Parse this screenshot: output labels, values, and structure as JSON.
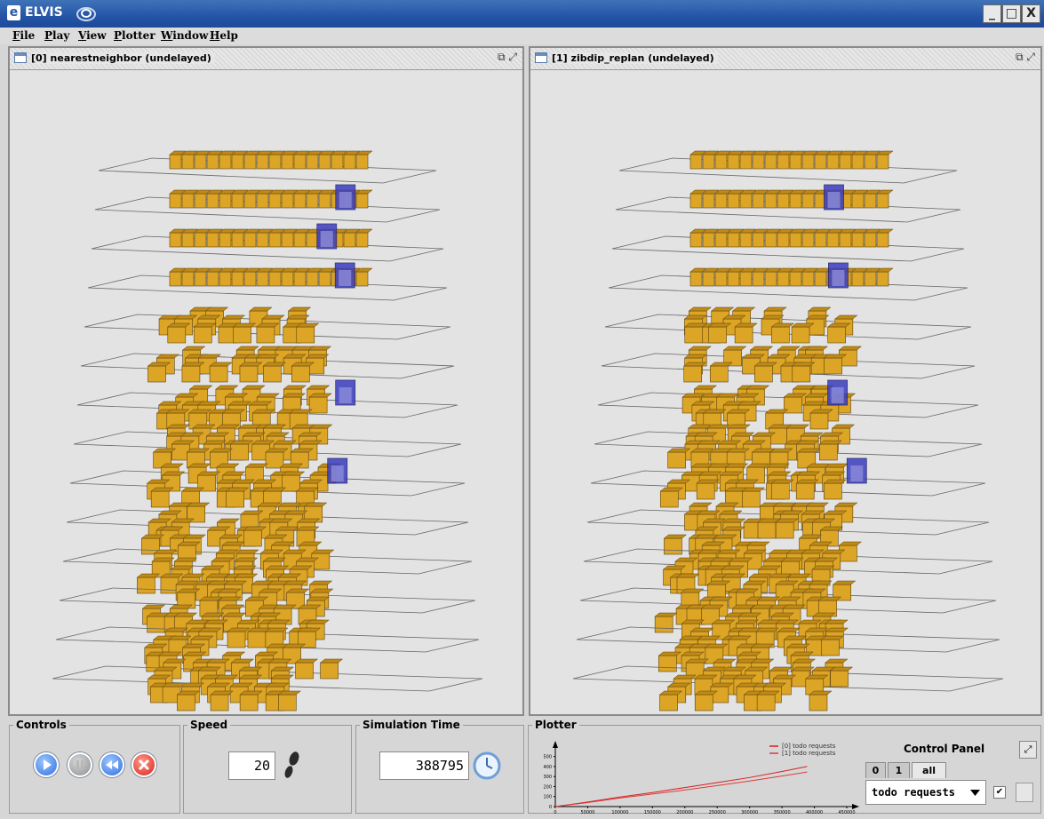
{
  "window": {
    "title": "ELVIS",
    "logo": "e"
  },
  "window_buttons": [
    "_",
    "□",
    "X"
  ],
  "menu": [
    {
      "first": "F",
      "rest": "ile"
    },
    {
      "first": "P",
      "rest": "lay"
    },
    {
      "first": "V",
      "rest": "iew"
    },
    {
      "first": "P",
      "rest": "lotter"
    },
    {
      "first": "W",
      "rest": "indow"
    },
    {
      "first": "H",
      "rest": "elp"
    }
  ],
  "frames": [
    {
      "title": "[0] nearestneighbor (undelayed)",
      "controls": "⧉ ⤢"
    },
    {
      "title": "[1] zibdip_replan (undelayed)",
      "controls": "⧉ ⤢"
    }
  ],
  "controls_panel": {
    "label": "Controls",
    "buttons": [
      "play-icon",
      "pause-icon",
      "rewind-icon",
      "stop-icon"
    ]
  },
  "speed_panel": {
    "label": "Speed",
    "value": "20"
  },
  "sim_time_panel": {
    "label": "Simulation Time",
    "value": "388795"
  },
  "plotter": {
    "label": "Plotter",
    "chart_data": {
      "type": "line",
      "legend": [
        "[0] todo requests",
        "[1] todo requests"
      ],
      "x_ticks": [
        "0",
        "50000",
        "100000",
        "150000",
        "200000",
        "250000",
        "300000",
        "350000",
        "400000",
        "450000"
      ],
      "y_ticks": [
        "0",
        "100",
        "200",
        "300",
        "400",
        "500"
      ],
      "xlim": [
        0,
        450000
      ],
      "ylim": [
        0,
        550
      ],
      "series": [
        {
          "name": "[0] todo requests",
          "x": [
            0,
            50000,
            100000,
            150000,
            200000,
            250000,
            300000,
            350000,
            388795
          ],
          "y": [
            0,
            45,
            95,
            140,
            190,
            240,
            290,
            350,
            400
          ]
        },
        {
          "name": "[1] todo requests",
          "x": [
            0,
            50000,
            100000,
            150000,
            200000,
            250000,
            300000,
            350000,
            388795
          ],
          "y": [
            0,
            40,
            85,
            125,
            165,
            210,
            255,
            305,
            345
          ]
        }
      ],
      "colors": [
        "#d42020",
        "#e03a3a"
      ]
    }
  },
  "control_panel": {
    "title": "Control Panel",
    "tabs": [
      "0",
      "1",
      "all"
    ],
    "selected_tab": "all",
    "dropdown_value": "todo requests",
    "checkbox_mark": "✔"
  },
  "colors": {
    "box": "#dca526",
    "box_blue": "#3a3dc0",
    "titlebar": "#2454a6"
  }
}
